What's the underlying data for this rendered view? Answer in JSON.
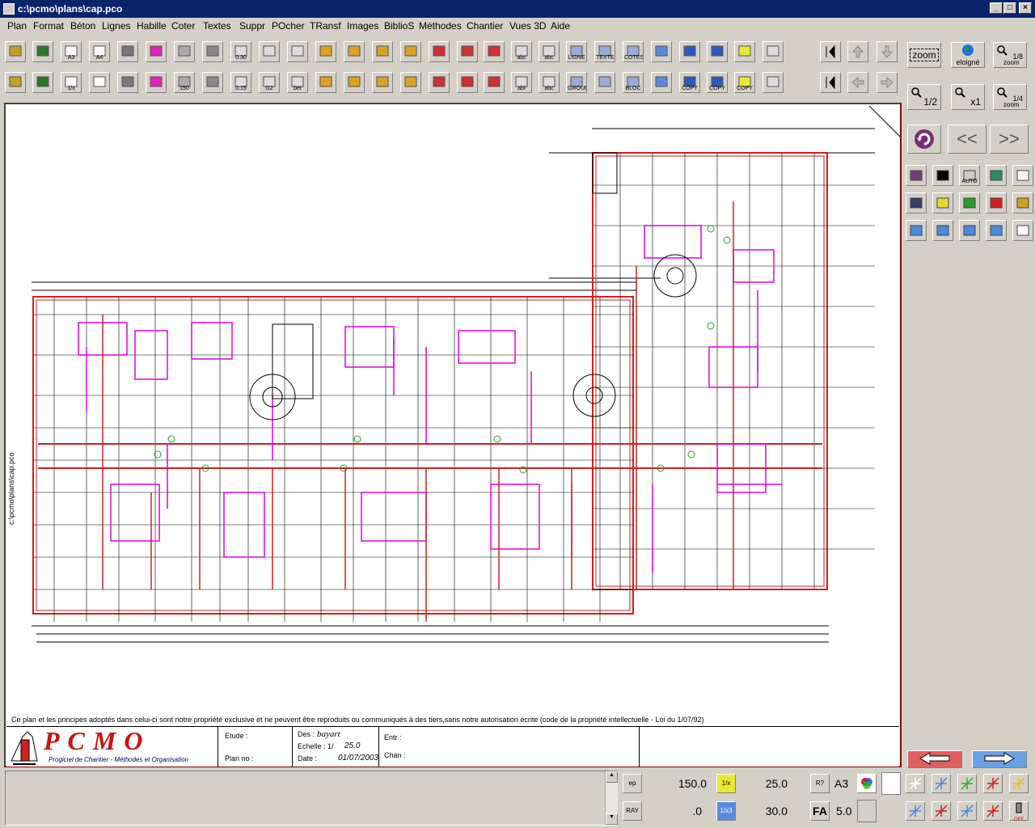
{
  "window": {
    "title": "c:\\pcmo\\plans\\cap.pco",
    "min": "_",
    "max": "□",
    "close": "×"
  },
  "menu": [
    "Plan",
    "Format",
    "Béton",
    "Lignes",
    "Habille",
    "Coter",
    "Textes",
    "Suppr",
    "POcher",
    "TRansf",
    "Images",
    "BiblioS",
    "Méthodes",
    "Chantier",
    "Vues 3D",
    "Aide"
  ],
  "toolbar1": [
    "",
    "",
    "A3",
    "A4",
    "",
    "",
    "",
    "",
    "0.30",
    "",
    "",
    "",
    "",
    "",
    "",
    "",
    "",
    "",
    "abc",
    "abc",
    "LIGNE",
    "TEXTE",
    "COTES",
    "",
    "",
    "",
    "",
    ""
  ],
  "toolbar2": [
    "",
    "",
    "1/x",
    "",
    "",
    "",
    "150",
    "",
    "0.15",
    "G2",
    "bet",
    "",
    "",
    "",
    "",
    "",
    "",
    "",
    "abI",
    "abc",
    "GROUP",
    "",
    "BLOC",
    "",
    "COPY",
    "COPY",
    "COPY",
    ""
  ],
  "right": {
    "zoom_label": "zoom",
    "eloigne_label": "eloigné",
    "zoom_18": "1/8",
    "zoom_sub": "zoom",
    "zoom_12": "1/2",
    "zoom_x1": "x1",
    "zoom_14": "1/4",
    "prev_label": "<<",
    "next_label": ">>",
    "auto_label": "AUTO"
  },
  "drawing": {
    "side_path": "c:\\pcmo\\plans\\cap.pco",
    "footnote": "Ce plan et les principes adoptés dans celui-ci sont notre propriété exclusive et ne peuvent être reproduits ou communiqués à des tiers,sans notre autorisation écrite (code de la propriété intellectuelle - Loi du 1/07/92)"
  },
  "cartouche": {
    "logo": "PCMO",
    "logo_sub": "Progiciel de Chantier - Méthodes et Organisation",
    "etude": "Etude :",
    "plan_no": "Plan no :",
    "des_label": "Des :",
    "des_value": "bayart",
    "echelle_label": "Echelle : 1/",
    "echelle_value": "25.0",
    "date_label": "Date :",
    "date_value": "01/07/2003",
    "entr": "Entr :",
    "chan": "Chan :"
  },
  "status": {
    "ep_label": "ep",
    "ray_label": "RAY",
    "v1": "150.0",
    "v2": "25.0",
    "v3": ".0",
    "v4": "30.0",
    "a3": "A3",
    "fa": "FA",
    "fa_val": "5.0",
    "inv_label": "1/x",
    "inv2_label": "1/x3",
    "r_label": "R?",
    "off_label": "OFF"
  },
  "colors": {
    "titlebar": "#0a246a",
    "face": "#d4d0c8",
    "wall": "#cc2222",
    "partition": "#e000e0",
    "ink": "#000000"
  }
}
